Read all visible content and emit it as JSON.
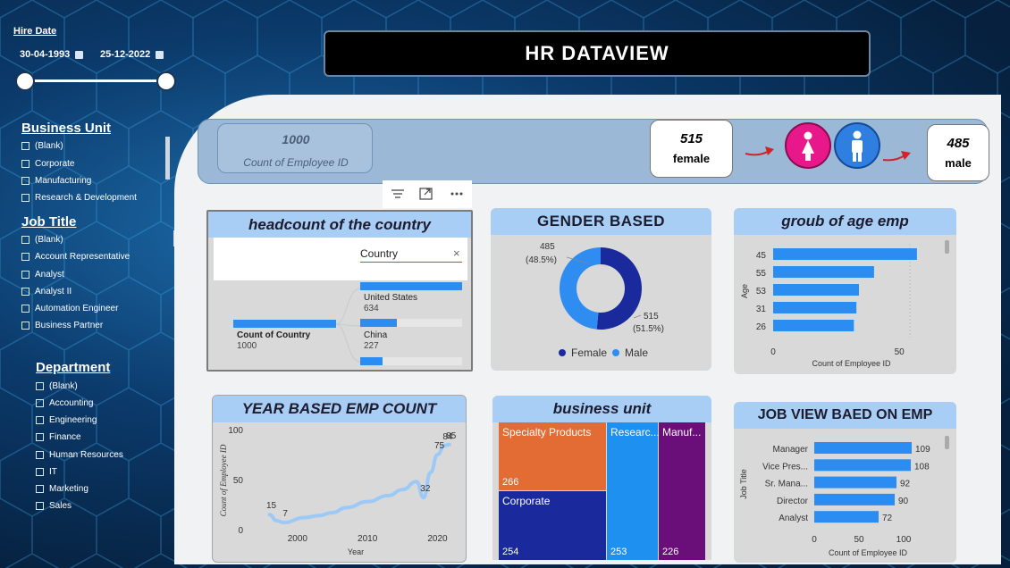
{
  "report_title": "HR DATAVIEW",
  "hire_date": {
    "label": "Hire Date",
    "start": "30-04-1993",
    "end": "25-12-2022"
  },
  "business_unit_slicer": {
    "title": "Business Unit",
    "items": [
      "(Blank)",
      "Corporate",
      "Manufacturing",
      "Research & Development"
    ]
  },
  "job_title_slicer": {
    "title": "Job Title",
    "items": [
      "(Blank)",
      "Account Representative",
      "Analyst",
      "Analyst II",
      "Automation Engineer",
      "Business Partner"
    ]
  },
  "department_slicer": {
    "title": "Department",
    "items": [
      "(Blank)",
      "Accounting",
      "Engineering",
      "Finance",
      "Human Resources",
      "IT",
      "Marketing",
      "Sales"
    ]
  },
  "kpi": {
    "count_value": "1000",
    "count_label": "Count of Employee ID",
    "female_value": "515",
    "female_label": "female",
    "male_value": "485",
    "male_label": "male"
  },
  "colors": {
    "female": "#e8188a",
    "male": "#2f7fe0",
    "bar": "#2b8cf2",
    "donut_female": "#1a2a9c",
    "donut_male": "#2f8cf0",
    "header": "#a9cef5"
  },
  "headcount": {
    "title": "headcount of the country",
    "search_placeholder": "Country",
    "root_label": "Count of Country",
    "root_value": "1000",
    "nodes": [
      {
        "name": "United States",
        "value": "634"
      },
      {
        "name": "China",
        "value": "227"
      }
    ]
  },
  "gender": {
    "title": "GENDER BASED",
    "legend": [
      "Female",
      "Male"
    ],
    "label_male": "485",
    "label_male_pct": "(48.5%)",
    "label_female": "515",
    "label_female_pct": "(51.5%)"
  },
  "age_chart_title": "groub of age emp",
  "year_chart_title": "YEAR BASED EMP COUNT",
  "business_unit_chart_title": "business unit",
  "job_chart_title": "JOB VIEW BAED ON EMP",
  "chart_data": [
    {
      "type": "pie",
      "categories": [
        "Female",
        "Male"
      ],
      "values": [
        515,
        485
      ]
    },
    {
      "type": "bar",
      "orientation": "horizontal",
      "categories": [
        "45",
        "55",
        "53",
        "31",
        "26"
      ],
      "values": [
        57,
        40,
        34,
        33,
        32
      ],
      "xlabel": "Count of Employee ID",
      "ylabel": "Age",
      "xticks": [
        "0",
        "50"
      ],
      "xlim": [
        0,
        62
      ]
    },
    {
      "type": "line",
      "x": [
        1996,
        1997,
        1998,
        2001,
        2003,
        2005,
        2007,
        2010,
        2013,
        2015,
        2017,
        2018,
        2019,
        2020,
        2021,
        2021.7
      ],
      "y": [
        15,
        9,
        7,
        12,
        14,
        17,
        22,
        28,
        34,
        40,
        48,
        32,
        57,
        75,
        84,
        85
      ],
      "point_labels": [
        {
          "x": 1996,
          "y": 15,
          "text": "15"
        },
        {
          "x": 1998,
          "y": 7,
          "text": "7"
        },
        {
          "x": 2018,
          "y": 32,
          "text": "32"
        },
        {
          "x": 2020,
          "y": 75,
          "text": "75"
        },
        {
          "x": 2021.7,
          "y": 85,
          "text": "85"
        },
        {
          "x": 2021.2,
          "y": 84,
          "text": "84"
        }
      ],
      "xlabel": "Year",
      "ylabel": "Count of Employee ID",
      "xticks": [
        "2000",
        "2010",
        "2020"
      ],
      "yticks": [
        "0",
        "50",
        "100"
      ],
      "xlim": [
        1993,
        2023
      ],
      "ylim": [
        0,
        100
      ]
    },
    {
      "type": "treemap",
      "categories": [
        "Specialty Products",
        "Corporate",
        "Researc...",
        "Manuf..."
      ],
      "values": [
        266,
        254,
        253,
        226
      ],
      "colors": [
        "#e36b34",
        "#1a2a9c",
        "#1e90f0",
        "#6a0f7a"
      ]
    },
    {
      "type": "bar",
      "orientation": "horizontal",
      "categories": [
        "Manager",
        "Vice Pres...",
        "Sr. Mana...",
        "Director",
        "Analyst"
      ],
      "values": [
        109,
        108,
        92,
        90,
        72
      ],
      "xlabel": "Count of Employee ID",
      "ylabel": "Job Title",
      "xticks": [
        "0",
        "50",
        "100"
      ],
      "xlim": [
        0,
        120
      ]
    }
  ]
}
